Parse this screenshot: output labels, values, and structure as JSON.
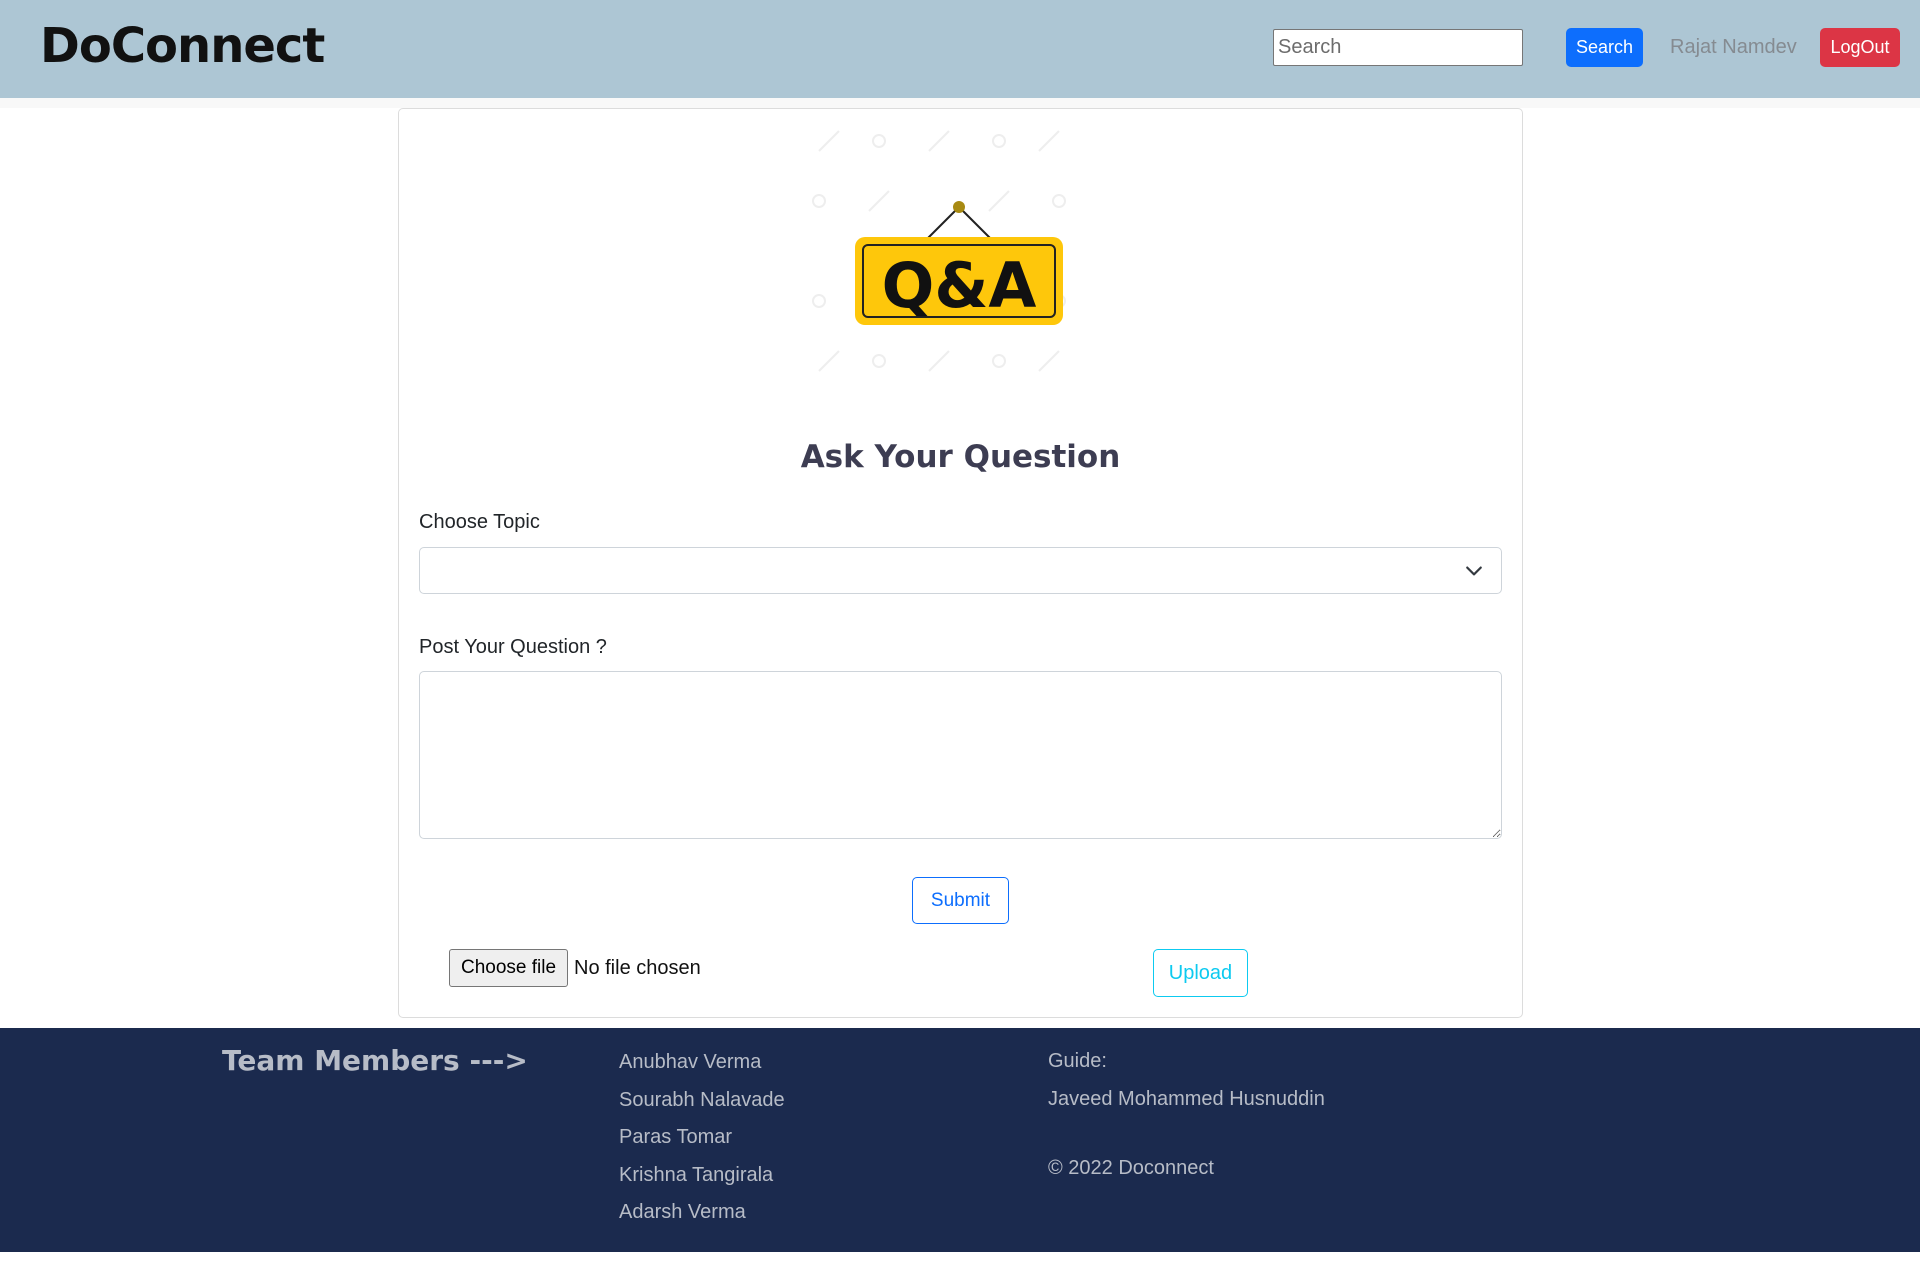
{
  "header": {
    "brand": "DoConnect",
    "search_placeholder": "Search",
    "search_button": "Search",
    "username": "Rajat Namdev",
    "logout_button": "LogOut"
  },
  "form": {
    "image_text": "Q&A",
    "title": "Ask Your Question",
    "topic_label": "Choose Topic",
    "topic_selected": "",
    "question_label": "Post Your Question ?",
    "question_value": "",
    "submit_button": "Submit",
    "file_button": "Choose file",
    "file_status": "No file chosen",
    "upload_button": "Upload"
  },
  "footer": {
    "team_heading": "Team Members --->",
    "members": [
      "Anubhav Verma",
      "Sourabh Nalavade",
      "Paras Tomar",
      "Krishna Tangirala",
      "Adarsh Verma"
    ],
    "guide_label": "Guide:",
    "guide_name": "Javeed Mohammed Husnuddin",
    "copyright": "© 2022 Doconnect"
  },
  "colors": {
    "navbar": "#adc6d4",
    "primary": "#0d6efd",
    "danger": "#dc3545",
    "info": "#0dcaf0",
    "footer": "#1b2a4e",
    "qa_sign": "#fec70b"
  }
}
